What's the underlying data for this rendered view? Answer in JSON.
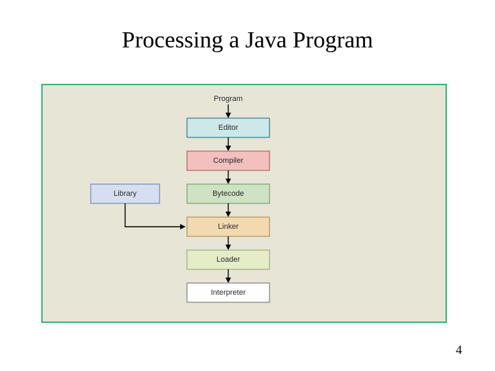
{
  "title": "Processing a Java Program",
  "page_number": "4",
  "diagram": {
    "nodes": {
      "program": {
        "label": "Program",
        "type": "text"
      },
      "editor": {
        "label": "Editor",
        "type": "box",
        "fill": "#cce8e8",
        "stroke": "#3a7f8f"
      },
      "compiler": {
        "label": "Compiler",
        "type": "box",
        "fill": "#f4bfbf",
        "stroke": "#b06a6a"
      },
      "bytecode": {
        "label": "Bytecode",
        "type": "box",
        "fill": "#cde3c4",
        "stroke": "#7da772"
      },
      "linker": {
        "label": "Linker",
        "type": "box",
        "fill": "#f3d9b0",
        "stroke": "#b49860"
      },
      "loader": {
        "label": "Loader",
        "type": "box",
        "fill": "#e4ecc8",
        "stroke": "#a5b27a"
      },
      "interpreter": {
        "label": "Interpreter",
        "type": "box",
        "fill": "#fefefe",
        "stroke": "#888888"
      },
      "library": {
        "label": "Library",
        "type": "box",
        "fill": "#d6dff2",
        "stroke": "#7a8fb8"
      }
    },
    "edges": [
      {
        "from": "program",
        "to": "editor"
      },
      {
        "from": "editor",
        "to": "compiler"
      },
      {
        "from": "compiler",
        "to": "bytecode"
      },
      {
        "from": "bytecode",
        "to": "linker"
      },
      {
        "from": "linker",
        "to": "loader"
      },
      {
        "from": "loader",
        "to": "interpreter"
      },
      {
        "from": "library",
        "to": "linker"
      }
    ]
  }
}
